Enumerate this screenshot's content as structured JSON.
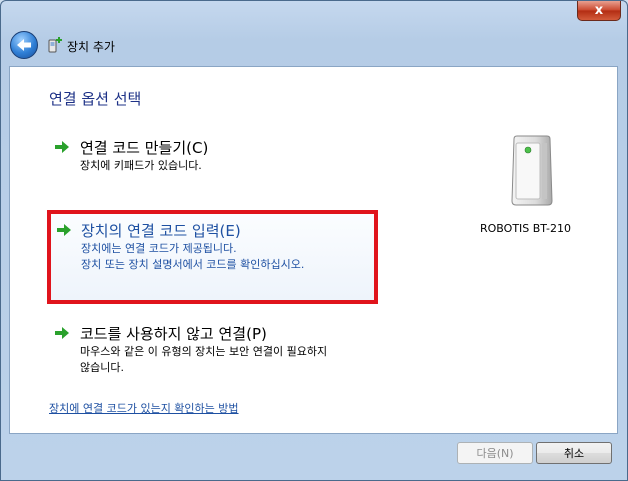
{
  "window": {
    "title": "장치 추가",
    "close_symbol": "x"
  },
  "main": {
    "heading": "연결 옵션 선택",
    "options": [
      {
        "title": "연결 코드 만들기(C)",
        "desc": [
          "장치에 키패드가 있습니다."
        ]
      },
      {
        "title": "장치의 연결 코드 입력(E)",
        "desc": [
          "장치에는 연결 코드가 제공됩니다.",
          "장치 또는 장치 설명서에서 코드를 확인하십시오."
        ]
      },
      {
        "title": "코드를 사용하지 않고 연결(P)",
        "desc": [
          "마우스와 같은 이 유형의 장치는 보안 연결이 필요하지",
          "않습니다."
        ]
      }
    ],
    "device_name": "ROBOTIS BT-210",
    "help_link": "장치에 연결 코드가 있는지 확인하는 방법"
  },
  "buttons": {
    "next": "다음(N)",
    "cancel": "취소"
  },
  "icons": {
    "back": "back-arrow-icon",
    "title": "add-device-icon",
    "option_arrow": "green-arrow-icon",
    "device": "device-tower-icon"
  },
  "colors": {
    "heading": "#1e3287",
    "highlight_border": "#e0141c",
    "link": "#1e50a2",
    "arrow": "#2aa12c"
  }
}
